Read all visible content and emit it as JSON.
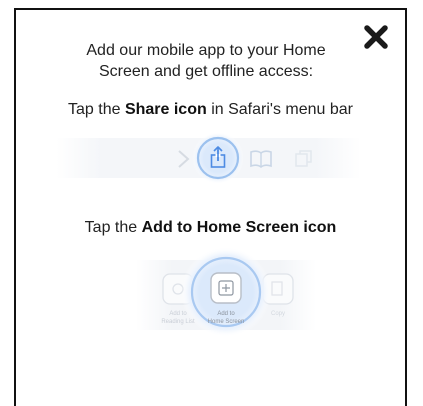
{
  "modal": {
    "intro_line1": "Add our mobile app to your Home",
    "intro_line2": "Screen and get offline access:",
    "step1": {
      "prefix": "Tap the ",
      "bold": "Share icon",
      "suffix": " in Safari's menu bar"
    },
    "step2": {
      "prefix": "Tap the ",
      "bold": "Add to Home Screen icon"
    },
    "sheet_labels": {
      "left_line1": "Add to",
      "left_line2": "Reading List",
      "center_line1": "Add to",
      "center_line2": "Home Screen",
      "right": "Copy"
    }
  },
  "icons": [
    "close-icon",
    "share-icon",
    "bookmarks-icon",
    "tabs-icon",
    "forward-icon",
    "add-icon"
  ]
}
